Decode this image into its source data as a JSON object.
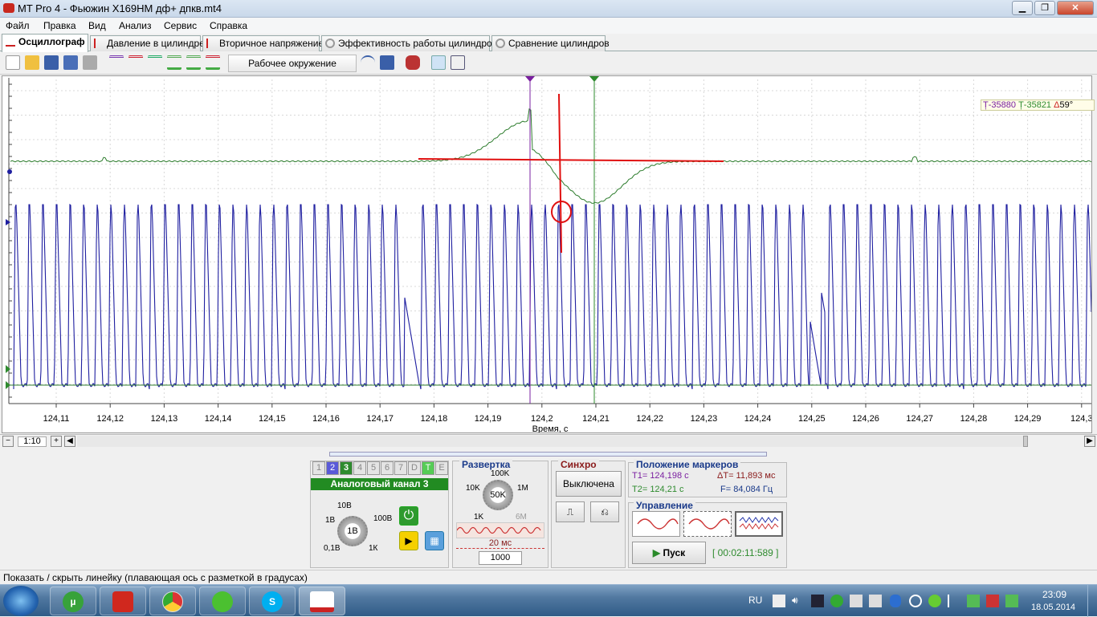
{
  "window": {
    "title": "MT Pro 4 - Фьюжин   X169HM  дф+ дпкв.mt4",
    "min": "▁",
    "max": "❐",
    "close": "✕"
  },
  "menu": [
    "Файл",
    "Правка",
    "Вид",
    "Анализ",
    "Сервис",
    "Справка"
  ],
  "tabs": [
    "Осциллограф",
    "Давление в цилиндре",
    "Вторичное напряжение",
    "Эффективность работы цилиндров",
    "Сравнение цилиндров"
  ],
  "toolbar": {
    "workspace": "Рабочее окружение"
  },
  "marker_readout": {
    "t1": "-35880",
    "t2": "-35821",
    "delta": "59°"
  },
  "axis": {
    "xlabel": "Время, с",
    "ticks": [
      "124,11",
      "124,12",
      "124,13",
      "124,14",
      "124,15",
      "124,16",
      "124,17",
      "124,18",
      "124,19",
      "124,2",
      "124,21",
      "124,22",
      "124,23",
      "124,24",
      "124,25",
      "124,26",
      "124,27",
      "124,28",
      "124,29",
      "124,3"
    ]
  },
  "zoom": "1:10",
  "channels": {
    "tabs": [
      "1",
      "2",
      "3",
      "4",
      "5",
      "6",
      "7",
      "D",
      "T",
      "E"
    ],
    "title": "Аналоговый канал 3",
    "knob_center": "1В",
    "knob_labels": [
      "10В",
      "100В",
      "1В",
      "0,1В",
      "1К"
    ]
  },
  "sweep": {
    "title": "Развертка",
    "knob_center": "50K",
    "knob_labels": [
      "100K",
      "10K",
      "1M",
      "1K",
      "6M"
    ],
    "time": "20 мс",
    "points": "1000"
  },
  "sync": {
    "title": "Синхро",
    "state": "Выключена"
  },
  "markers": {
    "title": "Положение маркеров",
    "t1": "T1= 124,198 с",
    "t2": "T2= 124,21 с",
    "dt": "ΔT= 11,893 мс",
    "f": "F= 84,084 Гц"
  },
  "control": {
    "title": "Управление",
    "start": "Пуск",
    "elapsed": "[ 00:02:11:589 ]"
  },
  "status": "Показать / скрыть линейку (плавающая ось с разметкой в градусах)",
  "tray": {
    "lang": "RU",
    "time": "23:09",
    "date": "18.05.2014"
  },
  "colors": {
    "ch2": "#1f1fa0",
    "ch3": "#2e7d2e",
    "marker1": "#7a1fa0",
    "marker2": "#2e8b2e",
    "annotation": "#e01010"
  }
}
